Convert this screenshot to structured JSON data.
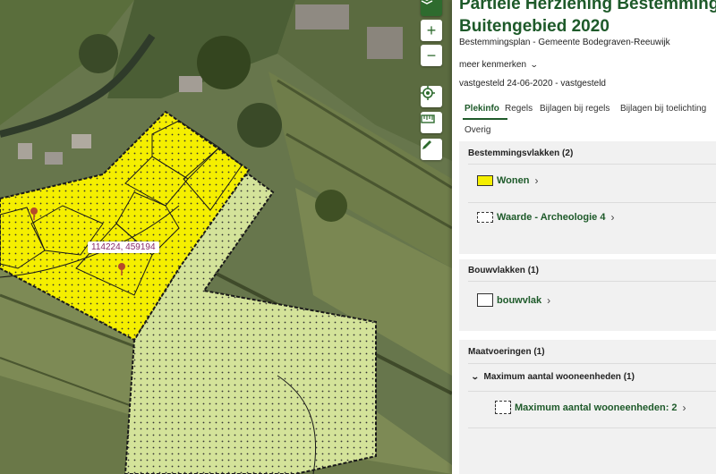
{
  "panel": {
    "title_line1": "Partiële Herziening Bestemmings",
    "title_line2": "Buitengebied 2020",
    "subtitle": "Bestemmingsplan - Gemeente Bodegraven-Reeuwijk",
    "more_label": "meer kenmerken",
    "status": "vastgesteld 24-06-2020 - vastgesteld",
    "tabs": [
      "Plekinfo",
      "Regels",
      "Bijlagen bij regels",
      "Bijlagen bij toelichting",
      "Overig"
    ],
    "sections": {
      "bestemmingsvlakken": {
        "heading": "Bestemmingsvlakken (2)",
        "items": [
          "Wonen",
          "Waarde - Archeologie 4"
        ]
      },
      "bouwvlakken": {
        "heading": "Bouwvlakken (1)",
        "items": [
          "bouwvlak"
        ]
      },
      "maatvoeringen": {
        "heading": "Maatvoeringen (1)",
        "group": "Maximum aantal wooneenheden (1)",
        "items": [
          "Maximum aantal wooneenheden: 2"
        ]
      }
    }
  },
  "map": {
    "coordinate_label": "114224, 459194",
    "colors": {
      "wonen": "#f5ef00",
      "agrarisch": "#d4e39a",
      "outline": "#1a1a1a",
      "marker": "#b54a2a"
    },
    "tools": [
      "layers-icon",
      "zoom-in-icon",
      "zoom-out-icon",
      "locate-icon",
      "measure-icon",
      "draw-icon"
    ]
  },
  "colors": {
    "brand": "#1e5a2a",
    "section_background": "#f1f1f1"
  }
}
